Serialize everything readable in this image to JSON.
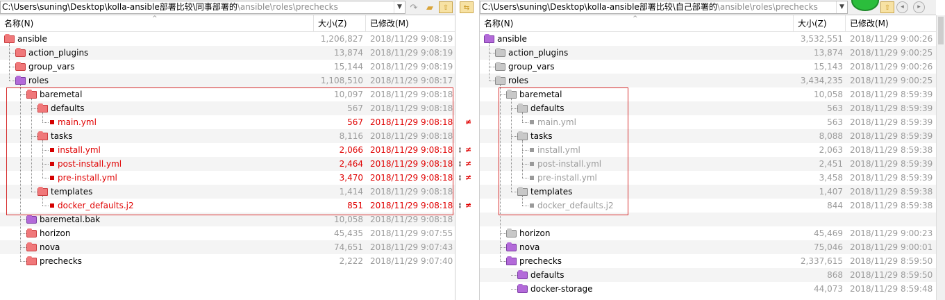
{
  "left": {
    "path_prefix": "C:\\Users\\suning\\Desktop\\kolla-ansible部署比较\\同事部署的",
    "path_rest": "\\ansible\\roles\\prechecks",
    "columns": {
      "name": "名称(N)",
      "size": "大小(Z)",
      "modified": "已修改(M)"
    },
    "rows": [
      {
        "name": "ansible",
        "size": "1,206,827",
        "date": "2018/11/29 9:08:19"
      },
      {
        "name": "action_plugins",
        "size": "13,874",
        "date": "2018/11/29 9:08:19"
      },
      {
        "name": "group_vars",
        "size": "15,144",
        "date": "2018/11/29 9:08:19"
      },
      {
        "name": "roles",
        "size": "1,108,510",
        "date": "2018/11/29 9:08:17"
      },
      {
        "name": "baremetal",
        "size": "10,097",
        "date": "2018/11/29 9:08:18"
      },
      {
        "name": "defaults",
        "size": "567",
        "date": "2018/11/29 9:08:18"
      },
      {
        "name": "main.yml",
        "size": "567",
        "date": "2018/11/29 9:08:18"
      },
      {
        "name": "tasks",
        "size": "8,116",
        "date": "2018/11/29 9:08:18"
      },
      {
        "name": "install.yml",
        "size": "2,066",
        "date": "2018/11/29 9:08:18"
      },
      {
        "name": "post-install.yml",
        "size": "2,464",
        "date": "2018/11/29 9:08:18"
      },
      {
        "name": "pre-install.yml",
        "size": "3,470",
        "date": "2018/11/29 9:08:18"
      },
      {
        "name": "templates",
        "size": "1,414",
        "date": "2018/11/29 9:08:18"
      },
      {
        "name": "docker_defaults.j2",
        "size": "851",
        "date": "2018/11/29 9:08:18"
      },
      {
        "name": "baremetal.bak",
        "size": "10,058",
        "date": "2018/11/29 9:08:18"
      },
      {
        "name": "horizon",
        "size": "45,435",
        "date": "2018/11/29 9:07:55"
      },
      {
        "name": "nova",
        "size": "74,651",
        "date": "2018/11/29 9:07:43"
      },
      {
        "name": "prechecks",
        "size": "2,222",
        "date": "2018/11/29 9:07:40"
      }
    ]
  },
  "right": {
    "path_prefix": "C:\\Users\\suning\\Desktop\\kolla-ansible部署比较\\自己部署的",
    "path_rest": "\\ansible\\roles\\prechecks",
    "columns": {
      "name": "名称(N)",
      "size": "大小(Z)",
      "modified": "已修改(M)"
    },
    "rows": [
      {
        "name": "ansible",
        "size": "3,532,551",
        "date": "2018/11/29 9:00:26"
      },
      {
        "name": "action_plugins",
        "size": "13,874",
        "date": "2018/11/29 9:00:25"
      },
      {
        "name": "group_vars",
        "size": "15,143",
        "date": "2018/11/29 9:00:26"
      },
      {
        "name": "roles",
        "size": "3,434,235",
        "date": "2018/11/29 9:00:25"
      },
      {
        "name": "baremetal",
        "size": "10,058",
        "date": "2018/11/29 8:59:39"
      },
      {
        "name": "defaults",
        "size": "563",
        "date": "2018/11/29 8:59:39"
      },
      {
        "name": "main.yml",
        "size": "563",
        "date": "2018/11/29 8:59:39"
      },
      {
        "name": "tasks",
        "size": "8,088",
        "date": "2018/11/29 8:59:39"
      },
      {
        "name": "install.yml",
        "size": "2,063",
        "date": "2018/11/29 8:59:38"
      },
      {
        "name": "post-install.yml",
        "size": "2,451",
        "date": "2018/11/29 8:59:39"
      },
      {
        "name": "pre-install.yml",
        "size": "3,458",
        "date": "2018/11/29 8:59:39"
      },
      {
        "name": "templates",
        "size": "1,407",
        "date": "2018/11/29 8:59:38"
      },
      {
        "name": "docker_defaults.j2",
        "size": "844",
        "date": "2018/11/29 8:59:38"
      },
      {
        "name": "",
        "size": "",
        "date": ""
      },
      {
        "name": "horizon",
        "size": "45,469",
        "date": "2018/11/29 9:00:23"
      },
      {
        "name": "nova",
        "size": "75,046",
        "date": "2018/11/29 9:00:01"
      },
      {
        "name": "prechecks",
        "size": "2,337,615",
        "date": "2018/11/29 8:59:50"
      },
      {
        "name": "defaults",
        "size": "868",
        "date": "2018/11/29 8:59:50"
      },
      {
        "name": "docker-storage",
        "size": "44,073",
        "date": "2018/11/29 8:59:48"
      }
    ]
  },
  "gutter": {
    "diff_glyph": "≠",
    "bars_glyph": "¦¦"
  },
  "colors": {
    "diff_red": "#e00000",
    "selection_border": "#d62b2b",
    "same_gray": "#9b9b9b",
    "folder_red": "#f0787a",
    "folder_purple": "#b36ad9",
    "folder_gray": "#c8c8c8"
  }
}
